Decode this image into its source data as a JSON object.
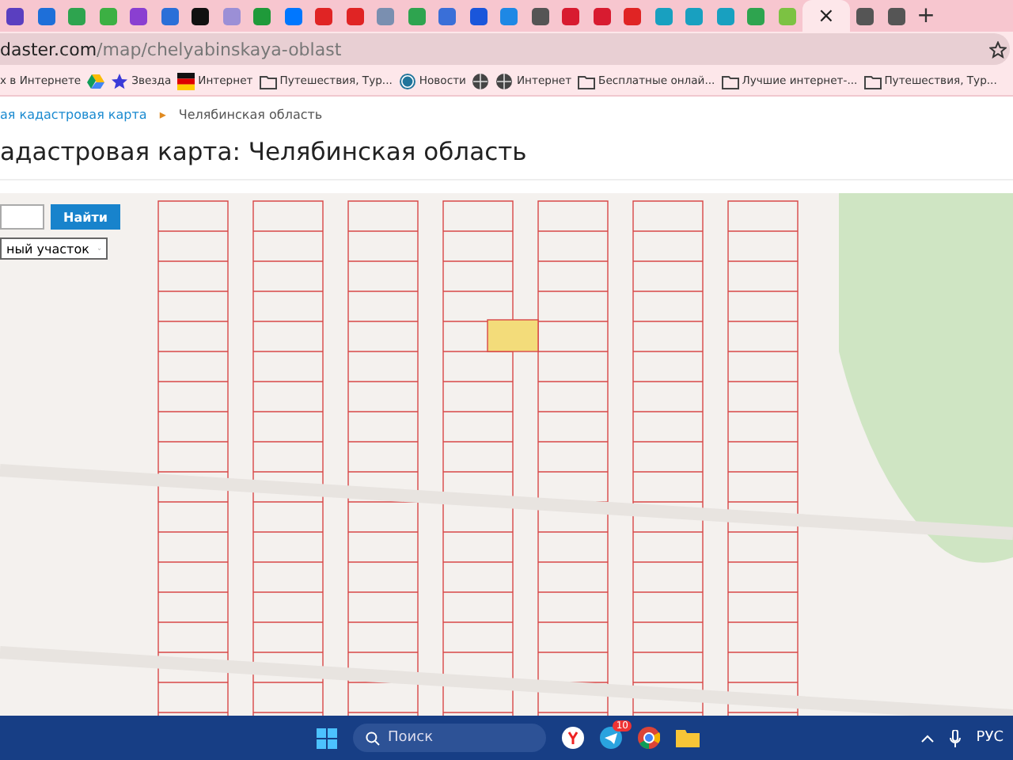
{
  "tabs": [
    {
      "color": "#5a3fc0",
      "selected": false
    },
    {
      "color": "#1e6fd9",
      "selected": false
    },
    {
      "color": "#2ea44f",
      "selected": false
    },
    {
      "color": "#3cb043",
      "selected": false
    },
    {
      "color": "#8a3fd1",
      "selected": false
    },
    {
      "color": "#2a6fd8",
      "selected": false
    },
    {
      "color": "#111111",
      "selected": false
    },
    {
      "color": "#9b8fd6",
      "selected": false
    },
    {
      "color": "#1f9a3a",
      "selected": false
    },
    {
      "color": "#0077ff",
      "selected": false
    },
    {
      "color": "#e02424",
      "selected": false
    },
    {
      "color": "#e02424",
      "selected": false
    },
    {
      "color": "#7a8fb0",
      "selected": false
    },
    {
      "color": "#2ea44f",
      "selected": false
    },
    {
      "color": "#3a6fd8",
      "selected": false
    },
    {
      "color": "#1a56db",
      "selected": false
    },
    {
      "color": "#1e88e5",
      "selected": false
    },
    {
      "color": "#555555",
      "selected": false
    },
    {
      "color": "#d81b30",
      "selected": false
    },
    {
      "color": "#d81b30",
      "selected": false
    },
    {
      "color": "#e02424",
      "selected": false
    },
    {
      "color": "#18a0c0",
      "selected": false
    },
    {
      "color": "#18a0c0",
      "selected": false
    },
    {
      "color": "#18a0c0",
      "selected": false
    },
    {
      "color": "#2ea44f",
      "selected": false
    },
    {
      "color": "#7cc242",
      "selected": false
    },
    {
      "selected": true,
      "close_label": "×"
    },
    {
      "color": "#555555",
      "selected": false
    },
    {
      "color": "#555555",
      "selected": false
    }
  ],
  "new_tab": "+",
  "address_bar": {
    "host": "daster.com",
    "path": "/map/chelyabinskaya-oblast"
  },
  "bookmarks": [
    {
      "kind": "text",
      "label": "х в Интернете"
    },
    {
      "kind": "drive"
    },
    {
      "kind": "star",
      "label": "Звезда"
    },
    {
      "kind": "flag",
      "label": "Интернет"
    },
    {
      "kind": "folder",
      "label": "Путешествия, Тур..."
    },
    {
      "kind": "wordpress",
      "label": "Новости"
    },
    {
      "kind": "globe"
    },
    {
      "kind": "globe",
      "label": "Интернет"
    },
    {
      "kind": "folder",
      "label": "Бесплатные онлай..."
    },
    {
      "kind": "folder",
      "label": "Лучшие интернет-..."
    },
    {
      "kind": "folder",
      "label": "Путешествия, Тур..."
    }
  ],
  "breadcrumb": {
    "link": "ая кадастровая карта",
    "separator": "▸",
    "current": "Челябинская область"
  },
  "heading": "адастровая карта: Челябинская область",
  "search": {
    "button": "Найти"
  },
  "type_select": {
    "value": "ный участок"
  },
  "taskbar": {
    "search_placeholder": "Поиск",
    "telegram_badge": "10",
    "language": "РУС"
  }
}
